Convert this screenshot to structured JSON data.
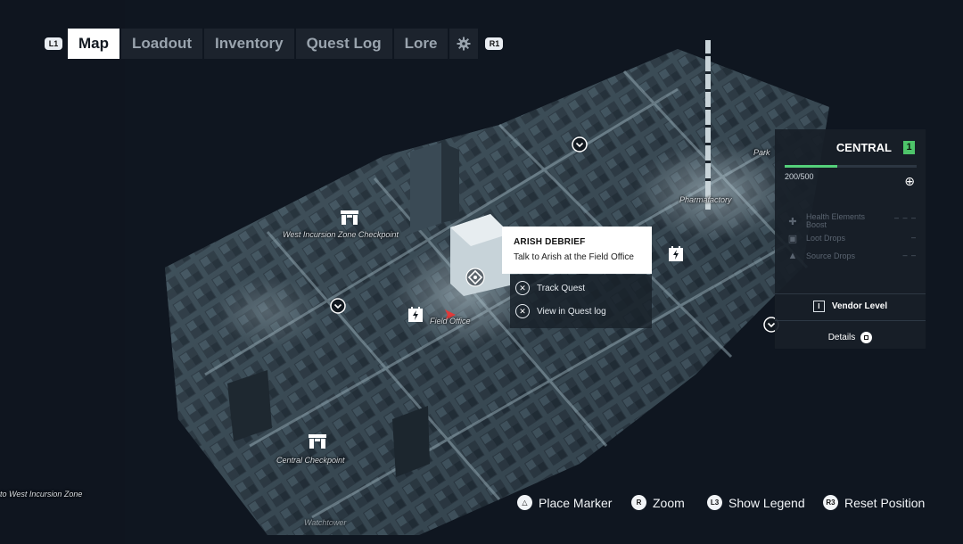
{
  "nav": {
    "left_shoulder": "L1",
    "right_shoulder": "R1",
    "tabs": [
      {
        "label": "Map",
        "active": true
      },
      {
        "label": "Loadout",
        "active": false
      },
      {
        "label": "Inventory",
        "active": false
      },
      {
        "label": "Quest Log",
        "active": false
      },
      {
        "label": "Lore",
        "active": false
      }
    ],
    "settings_icon": "gear-icon"
  },
  "map": {
    "labels": {
      "west_checkpoint": "West Incursion Zone Checkpoint",
      "central_checkpoint": "Central Checkpoint",
      "field_office": "Field Office",
      "factory": "Pharmafactory",
      "park": "Park",
      "to_west_zone": "to West Incursion Zone",
      "watchtower": "Watchtower"
    },
    "icons": {
      "checkpoint": "checkpoint-gate-icon",
      "shield": "shield-marker-icon",
      "power": "power-station-icon",
      "quest": "quest-diamond-icon",
      "player": "player-arrow-icon",
      "tower": "antenna-tower-icon"
    }
  },
  "quest_popup": {
    "title": "ARISH DEBRIEF",
    "subtitle": "Talk to Arish at the Field Office",
    "actions": [
      {
        "label": "Track Quest",
        "button": "✕"
      },
      {
        "label": "View in Quest log",
        "button": "✕"
      }
    ]
  },
  "district_panel": {
    "name": "CENTRAL",
    "level": "1",
    "xp_text": "200/500",
    "xp_progress": 0.4,
    "rewards": [
      {
        "label": "Health Elements Boost",
        "icon": "health-plus-icon",
        "value": "– – –"
      },
      {
        "label": "Loot Drops",
        "icon": "loot-crate-icon",
        "value": "–"
      },
      {
        "label": "Source Drops",
        "icon": "source-crystal-icon",
        "value": "– –"
      }
    ],
    "vendor_key": "I",
    "vendor_label": "Vendor Level",
    "details_label": "Details"
  },
  "controls": [
    {
      "key": "△",
      "label": "Place Marker"
    },
    {
      "key": "R",
      "label": "Zoom"
    },
    {
      "key": "L3",
      "label": "Show Legend"
    },
    {
      "key": "R3",
      "label": "Reset Position"
    }
  ],
  "colors": {
    "background": "#0f1620",
    "map_light": "#a8bcc6",
    "xp_green": "#54d07a",
    "level_badge": "#4ec46a",
    "player_marker": "#e03a3a"
  }
}
